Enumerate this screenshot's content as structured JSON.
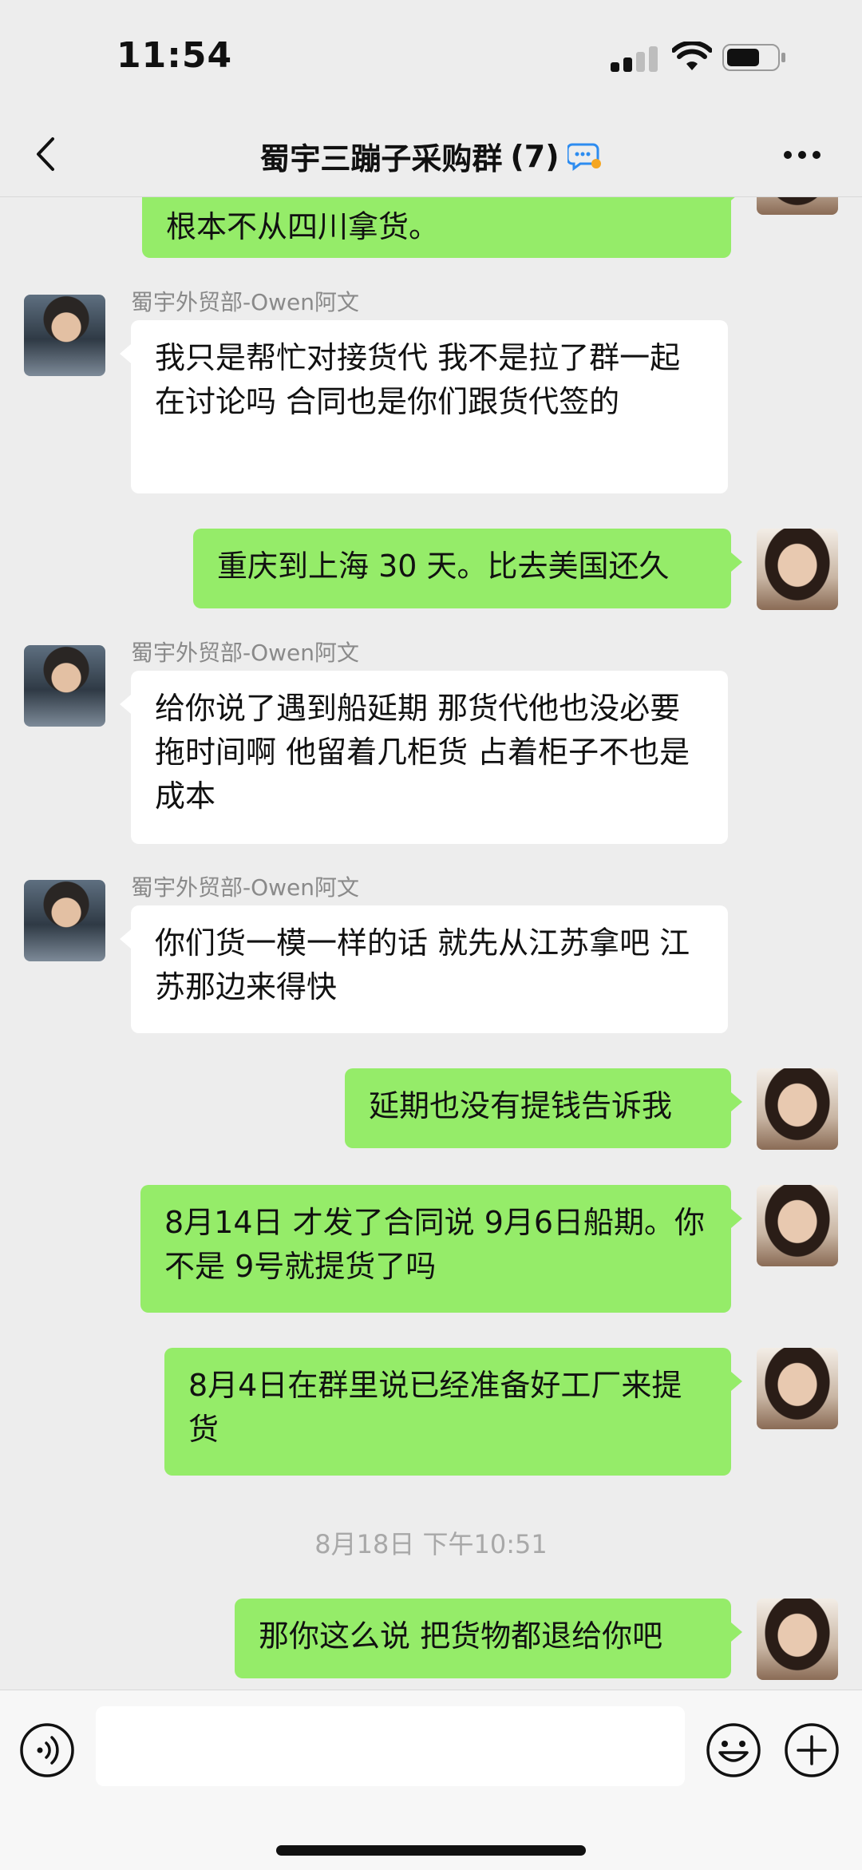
{
  "status_bar": {
    "time": "11:54"
  },
  "header": {
    "title": "蜀宇三蹦子采购群",
    "member_count": "(7)"
  },
  "messages": [
    {
      "side": "right",
      "text": "根本不从四川拿货。"
    },
    {
      "side": "left",
      "sender": "蜀宇外贸部-Owen阿文",
      "text": "我只是帮忙对接货代 我不是拉了群一起在讨论吗 合同也是你们跟货代签的"
    },
    {
      "side": "right",
      "text": "重庆到上海 30 天。比去美国还久"
    },
    {
      "side": "left",
      "sender": "蜀宇外贸部-Owen阿文",
      "text": "给你说了遇到船延期 那货代他也没必要拖时间啊 他留着几柜货 占着柜子不也是成本"
    },
    {
      "side": "left",
      "sender": "蜀宇外贸部-Owen阿文",
      "text": "你们货一模一样的话 就先从江苏拿吧 江苏那边来得快"
    },
    {
      "side": "right",
      "text": "延期也没有提钱告诉我"
    },
    {
      "side": "right",
      "text": "8月14日 才发了合同说 9月6日船期。你不是 9号就提货了吗"
    },
    {
      "side": "right",
      "text": "8月4日在群里说已经准备好工厂来提货"
    },
    {
      "side": "right",
      "text": "那你这么说 把货物都退给你吧"
    }
  ],
  "timestamp": "8月18日 下午10:51",
  "input": {
    "placeholder": ""
  },
  "colors": {
    "background": "#ededed",
    "bubble_self": "#95ec69",
    "bubble_other": "#ffffff"
  },
  "icons": [
    "back-icon",
    "group-chat-icon",
    "more-icon",
    "voice-icon",
    "emoji-icon",
    "plus-icon"
  ]
}
